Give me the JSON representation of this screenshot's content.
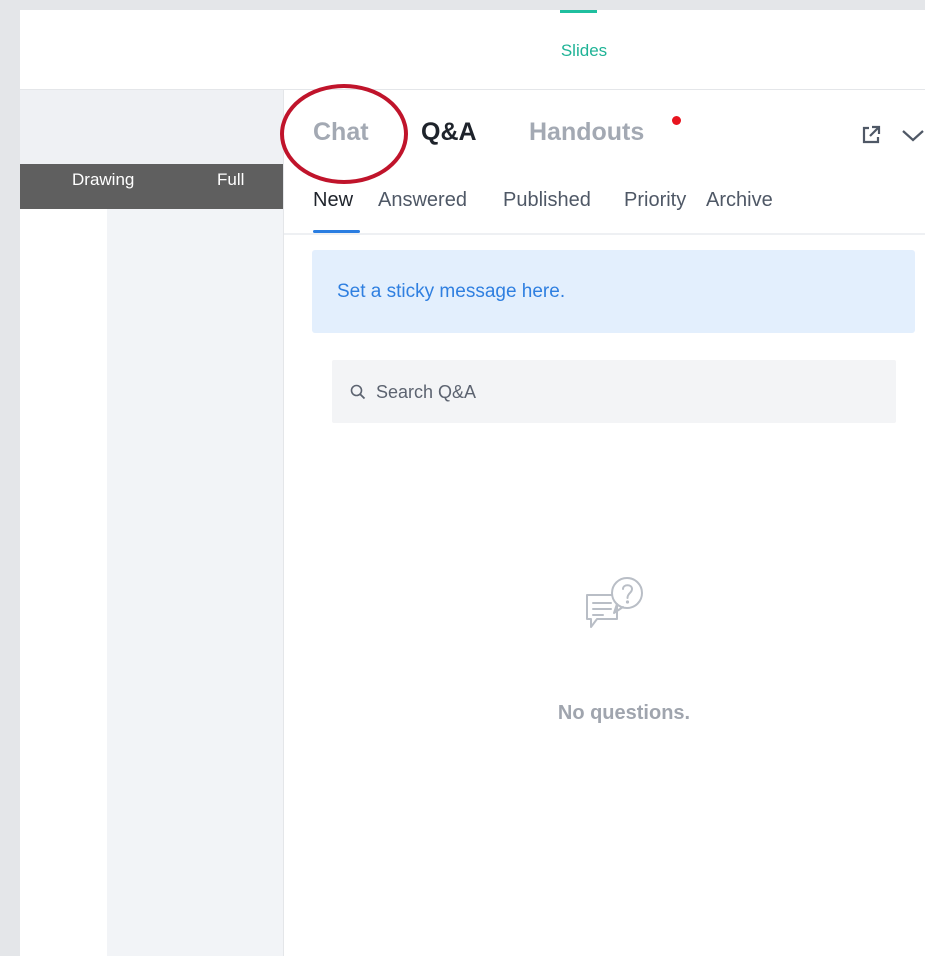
{
  "topbar": {
    "slides_label": "Slides"
  },
  "tools": {
    "drawing_label": "Drawing",
    "full_label": "Full"
  },
  "panel": {
    "tabs": {
      "chat": "Chat",
      "qa": "Q&A",
      "handouts": "Handouts"
    },
    "subtabs": {
      "new": "New",
      "answered": "Answered",
      "published": "Published",
      "priority": "Priority",
      "archive": "Archive"
    },
    "sticky_message": "Set a sticky message here.",
    "search_placeholder": "Search Q&A",
    "empty_state": "No questions."
  },
  "colors": {
    "accent_teal": "#1fb396",
    "active_blue": "#2a7de1",
    "notification_red": "#e8141f",
    "annotation_circle": "#c0142b"
  },
  "icons": [
    "popout-icon",
    "chevron-down-icon",
    "search-icon",
    "question-chat-icon"
  ]
}
